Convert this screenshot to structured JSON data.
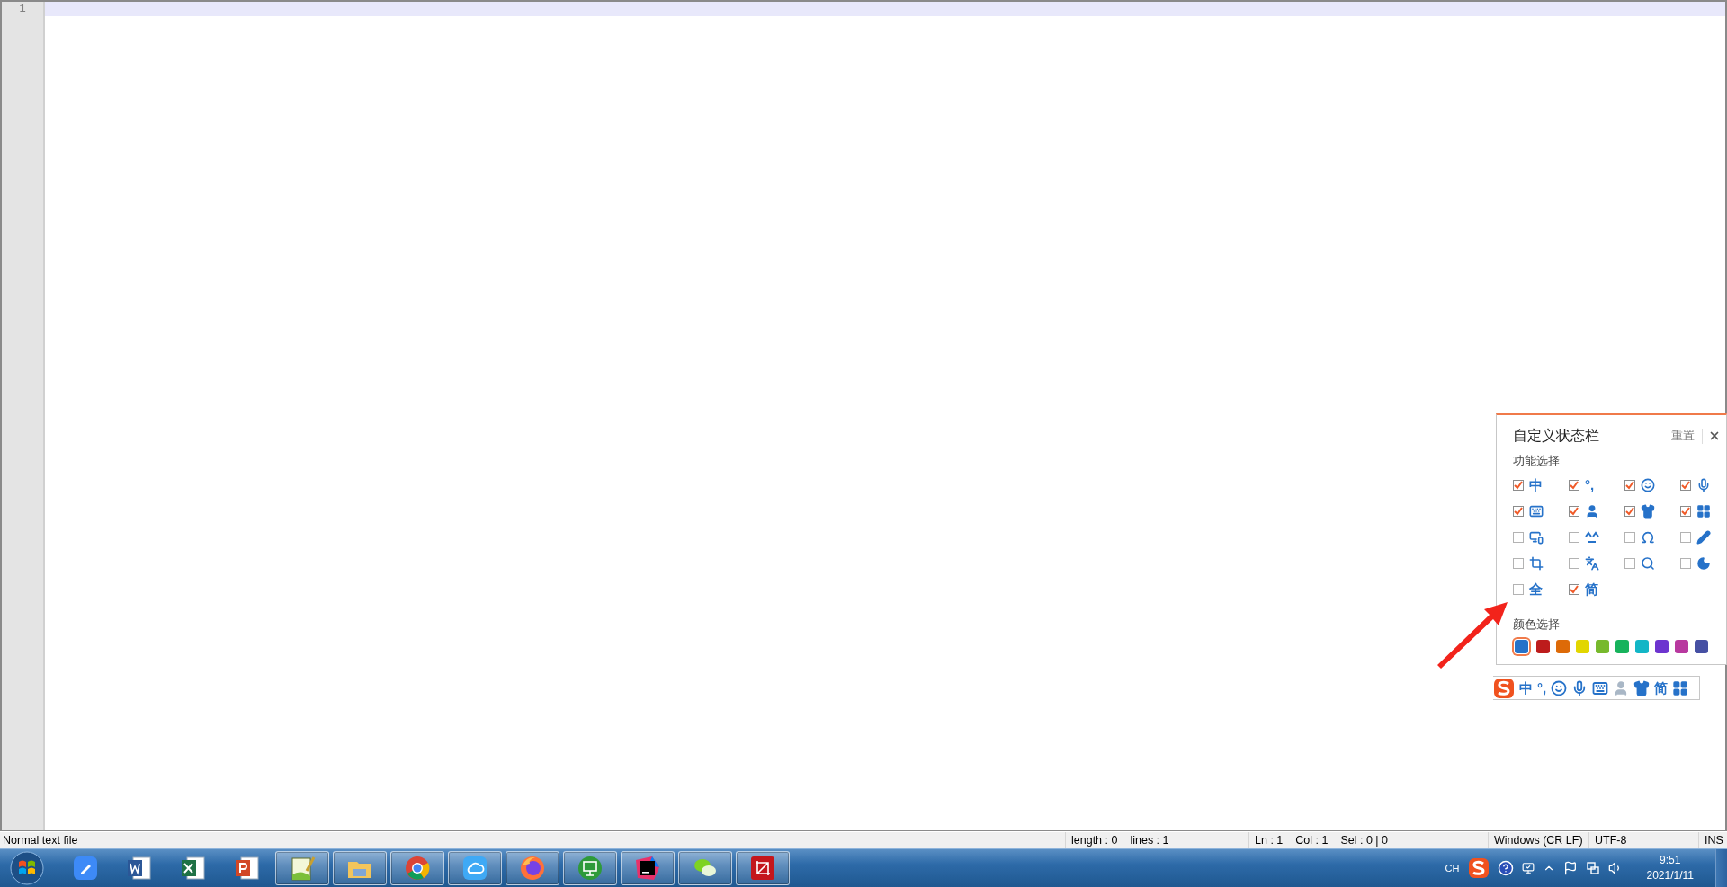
{
  "editor": {
    "line_numbers": [
      "1"
    ]
  },
  "status_bar": {
    "segments": [
      {
        "kind": "wide",
        "text": "Normal text file"
      },
      {
        "kind": "pair",
        "texts": [
          "length : 0",
          "lines : 1"
        ]
      },
      {
        "kind": "triple",
        "texts": [
          "Ln : 1",
          "Col : 1",
          "Sel : 0 | 0"
        ]
      },
      {
        "kind": "cell",
        "text": "Windows (CR LF)"
      },
      {
        "kind": "cell",
        "text": "UTF-8"
      },
      {
        "kind": "cell",
        "text": "INS"
      }
    ]
  },
  "status_panel": {
    "title": "自定义状态栏",
    "reset": "重置",
    "section_features": "功能选择",
    "features": [
      {
        "kind": "text",
        "label": "中",
        "checked": true
      },
      {
        "kind": "text",
        "label": "°,",
        "checked": true
      },
      {
        "kind": "smile",
        "checked": true
      },
      {
        "kind": "mic",
        "checked": true
      },
      {
        "kind": "keyboard",
        "checked": true
      },
      {
        "kind": "user",
        "checked": true
      },
      {
        "kind": "shirt",
        "checked": true
      },
      {
        "kind": "grid",
        "checked": true
      },
      {
        "kind": "devices",
        "checked": false
      },
      {
        "kind": "emoticon",
        "checked": false
      },
      {
        "kind": "omega",
        "checked": false
      },
      {
        "kind": "pen",
        "checked": false
      },
      {
        "kind": "crop",
        "checked": false
      },
      {
        "kind": "translate",
        "checked": false
      },
      {
        "kind": "search",
        "checked": false
      },
      {
        "kind": "moon",
        "checked": false
      },
      {
        "kind": "text",
        "label": "全",
        "checked": false
      },
      {
        "kind": "text",
        "label": "简",
        "checked": true
      }
    ],
    "section_colors": "颜色选择",
    "colors": [
      {
        "color": "#2672c9",
        "selected": true
      },
      {
        "color": "#bd1c1c",
        "selected": false
      },
      {
        "color": "#dd6a08",
        "selected": false
      },
      {
        "color": "#e2d600",
        "selected": false
      },
      {
        "color": "#77b92c",
        "selected": false
      },
      {
        "color": "#17b35c",
        "selected": false
      },
      {
        "color": "#12b6c6",
        "selected": false
      },
      {
        "color": "#6d34cf",
        "selected": false
      },
      {
        "color": "#b8389f",
        "selected": false
      },
      {
        "color": "#4650a3",
        "selected": false
      }
    ]
  },
  "ime_toolbar": {
    "items": [
      {
        "kind": "logo"
      },
      {
        "kind": "text",
        "label": "中"
      },
      {
        "kind": "text",
        "label": "°,"
      },
      {
        "kind": "smile"
      },
      {
        "kind": "mic"
      },
      {
        "kind": "keyboard"
      },
      {
        "kind": "user_faded"
      },
      {
        "kind": "shirt"
      },
      {
        "kind": "text",
        "label": "简"
      },
      {
        "kind": "grid"
      }
    ]
  },
  "taskbar": {
    "apps": [
      {
        "kind": "pen",
        "running": false
      },
      {
        "kind": "word",
        "running": false
      },
      {
        "kind": "excel",
        "running": false
      },
      {
        "kind": "powerpoint",
        "running": false
      },
      {
        "kind": "notepad",
        "running": true
      },
      {
        "kind": "folder",
        "running": true
      },
      {
        "kind": "chrome",
        "running": true
      },
      {
        "kind": "cloud",
        "running": true
      },
      {
        "kind": "firefox",
        "running": true
      },
      {
        "kind": "screen",
        "running": true
      },
      {
        "kind": "ide",
        "running": true
      },
      {
        "kind": "chat",
        "running": true
      },
      {
        "kind": "crop",
        "running": true
      }
    ],
    "tray": {
      "language": "CH",
      "time": "9:51",
      "date": "2021/1/11"
    }
  }
}
